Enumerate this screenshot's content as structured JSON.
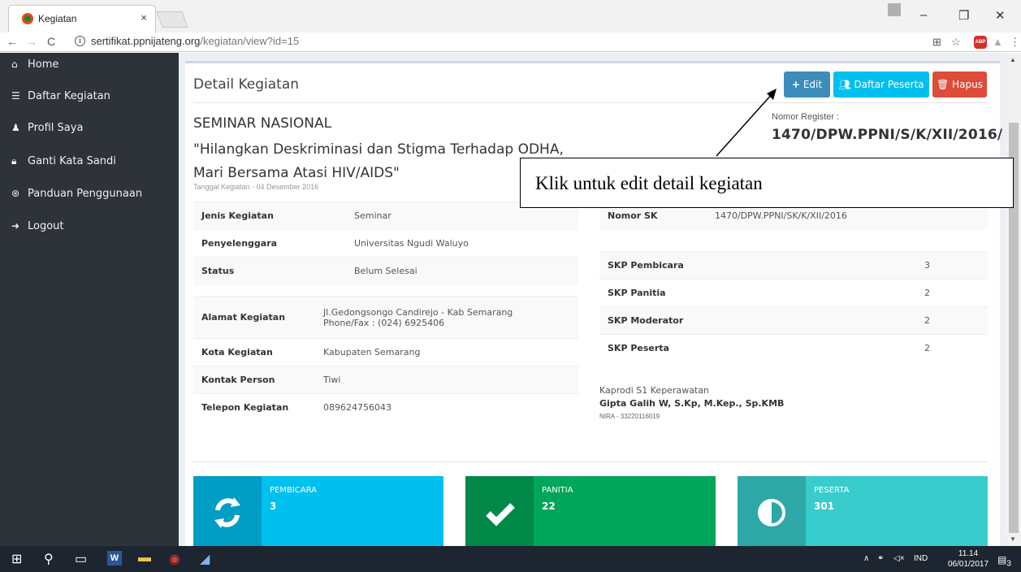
{
  "browser": {
    "tab_title": "Kegiatan",
    "tab_close": "×",
    "url_host": "sertifikat.ppnijateng.org",
    "url_path": "/kegiatan/view?id=15",
    "abp": "ABP",
    "window_controls": {
      "minimize": "–",
      "maximize": "❐",
      "close": "✕"
    }
  },
  "sidebar": {
    "items": [
      {
        "label": "Home",
        "icon": "home-icon"
      },
      {
        "label": "Daftar Kegiatan",
        "icon": "list-icon"
      },
      {
        "label": "Profil Saya",
        "icon": "user-icon"
      },
      {
        "label": "Ganti Kata Sandi",
        "icon": "lock-icon"
      },
      {
        "label": "Panduan Penggunaan",
        "icon": "lifebuoy-icon"
      },
      {
        "label": "Logout",
        "icon": "sign-out-icon"
      }
    ]
  },
  "header": {
    "title": "Detail Kegiatan",
    "edit_label": "Edit",
    "peserta_label": "Daftar Peserta",
    "hapus_label": "Hapus"
  },
  "event": {
    "type": "SEMINAR NASIONAL",
    "title": "\"Hilangkan Deskriminasi dan Stigma Terhadap ODHA, Mari Bersama Atasi HIV/AIDS\"",
    "date": "Tanggal Kegiatan - 04 Desember 2016",
    "register_label": "Nomor Register :",
    "register_value": "1470/DPW.PPNI/S/K/XII/2016/"
  },
  "table_left_1": [
    {
      "key": "Jenis Kegiatan",
      "value": "Seminar"
    },
    {
      "key": "Penyelenggara",
      "value": "Universitas Ngudi Waluyo"
    },
    {
      "key": "Status",
      "value": "Belum Selesai"
    }
  ],
  "table_left_2": [
    {
      "key": "Alamat Kegiatan",
      "value": "Jl.Gedongsongo Candirejo - Kab Semarang",
      "value2": "Phone/Fax : (024) 6925406"
    },
    {
      "key": "Kota Kegiatan",
      "value": "Kabupaten Semarang"
    },
    {
      "key": "Kontak Person",
      "value": "Tiwi"
    },
    {
      "key": "Telepon Kegiatan",
      "value": "089624756043"
    }
  ],
  "table_right_1": [
    {
      "key": "Nomor SK",
      "value": "1470/DPW.PPNI/SK/K/XII/2016"
    }
  ],
  "table_right_2": [
    {
      "key": "SKP Pembicara",
      "value": "3"
    },
    {
      "key": "SKP Panitia",
      "value": "2"
    },
    {
      "key": "SKP Moderator",
      "value": "2"
    },
    {
      "key": "SKP Peserta",
      "value": "2"
    }
  ],
  "signatory": {
    "role": "Kaprodi S1 Keperawatan",
    "name": "Gipta Galih W, S.Kp, M.Kep., Sp.KMB",
    "nira": "NIRA - 33220116019"
  },
  "info_boxes": [
    {
      "label": "PEMBICARA",
      "value": "3",
      "icon": "refresh-icon",
      "color": "#00c0ef"
    },
    {
      "label": "PANITIA",
      "value": "22",
      "icon": "check-icon",
      "color": "#00a65a"
    },
    {
      "label": "PESERTA",
      "value": "301",
      "icon": "adjust-icon",
      "color": "#39cccc"
    }
  ],
  "annotation": {
    "text": "Klik untuk edit detail kegiatan"
  },
  "taskbar": {
    "language": "IND",
    "time": "11.14",
    "date": "06/01/2017",
    "notifications": "3"
  }
}
